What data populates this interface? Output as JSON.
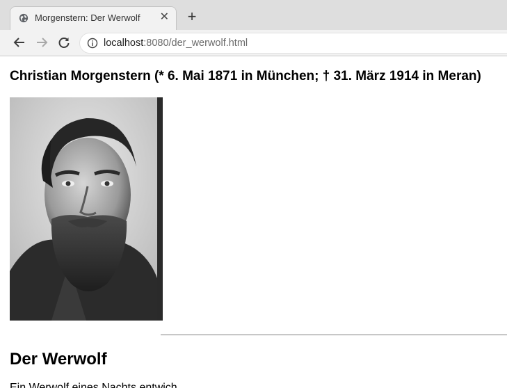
{
  "browser": {
    "tab_title": "Morgenstern: Der Werwolf",
    "tab_close": "✕",
    "new_tab": "+",
    "url_host": "localhost",
    "url_rest": ":8080/der_werwolf.html"
  },
  "page": {
    "author_heading": "Christian Morgenstern (* 6. Mai 1871 in München; † 31. März 1914 in Meran)",
    "poem_title": "Der Werwolf",
    "poem_first_line": "Ein Werwolf eines Nachts entwich"
  },
  "colors": {
    "tabstrip": "#dedede",
    "toolbar": "#f2f2f2",
    "page_background": "#ffffff"
  }
}
